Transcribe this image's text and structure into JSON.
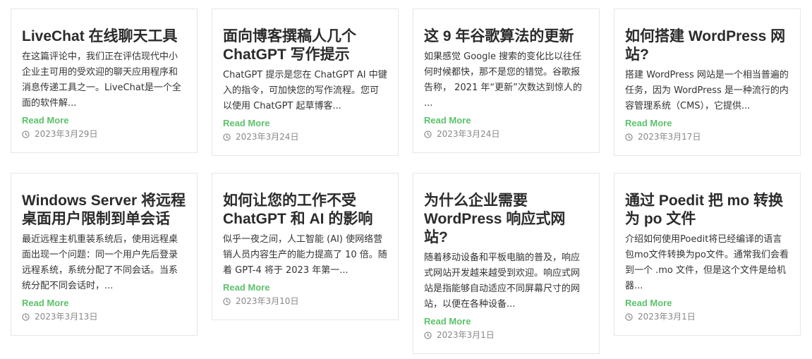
{
  "posts": [
    {
      "title": "LiveChat 在线聊天工具",
      "excerpt": "在这篇评论中，我们正在评估现代中小企业主可用的受欢迎的聊天应用程序和消息传递工具之一。LiveChat是一个全面的软件解...",
      "read_more": "Read More",
      "date": "2023年3月29日"
    },
    {
      "title": "面向博客撰稿人几个 ChatGPT 写作提示",
      "excerpt": "ChatGPT 提示是您在 ChatGPT AI 中键入的指令，可加快您的写作流程。您可以使用 ChatGPT 起草博客...",
      "read_more": "Read More",
      "date": "2023年3月24日"
    },
    {
      "title": "这 9 年谷歌算法的更新",
      "excerpt": "如果感觉 Google 搜索的变化比以往任何时候都快，那不是您的错觉。谷歌报告称， 2021 年“更新”次数达到惊人的 ...",
      "read_more": "Read More",
      "date": "2023年3月24日"
    },
    {
      "title": "如何搭建 WordPress 网站?",
      "excerpt": "搭建 WordPress 网站是一个相当普遍的任务，因为 WordPress 是一种流行的内容管理系统（CMS），它提供...",
      "read_more": "Read More",
      "date": "2023年3月17日"
    },
    {
      "title": "Windows Server 将远程桌面用户限制到单会话",
      "excerpt": "最近远程主机重装系统后，使用远程桌面出现一个问题：同一个用户先后登录远程系统，系统分配了不同会话。当系统分配不同会话时，...",
      "read_more": "Read More",
      "date": "2023年3月13日"
    },
    {
      "title": "如何让您的工作不受 ChatGPT 和 AI 的影响",
      "excerpt": "似乎一夜之间，人工智能 (AI) 使网络营销人员内容生产的能力提高了 10 倍。随着 GPT-4 将于 2023 年第一...",
      "read_more": "Read More",
      "date": "2023年3月10日"
    },
    {
      "title": "为什么企业需要 WordPress 响应式网站?",
      "excerpt": "随着移动设备和平板电脑的普及，响应式网站开发越来越受到欢迎。响应式网站是指能够自动适应不同屏幕尺寸的网站，以便在各种设备...",
      "read_more": "Read More",
      "date": "2023年3月1日"
    },
    {
      "title": "通过 Poedit 把 mo 转换为 po 文件",
      "excerpt": "介绍如何使用Poedit将已经编译的语言包mo文件转换为po文件。通常我们会看到一个 .mo 文件，但是这个文件是给机器...",
      "read_more": "Read More",
      "date": "2023年3月1日"
    }
  ],
  "icons": {
    "date_icon": "clock-icon"
  },
  "colors": {
    "title": "#2b2b2b",
    "excerpt": "#333333",
    "read_more": "#5cc26a",
    "date": "#888888",
    "card_border": "#e6e6e6"
  }
}
